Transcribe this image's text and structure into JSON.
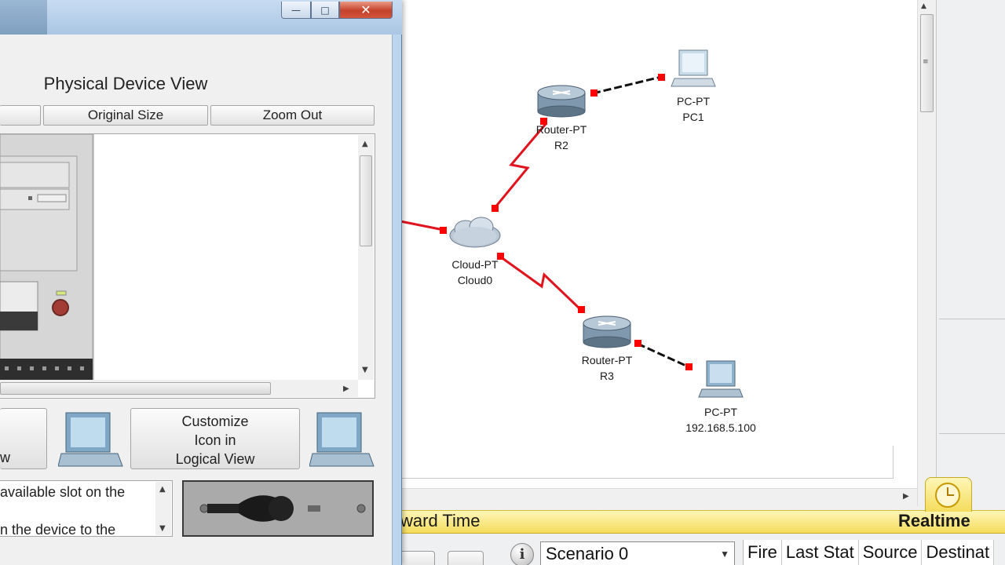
{
  "workspace": {
    "devices": [
      {
        "name": "cloud",
        "type_label": "Cloud-PT",
        "name_label": "Cloud0"
      },
      {
        "name": "router-r2",
        "type_label": "Router-PT",
        "name_label": "R2"
      },
      {
        "name": "router-r3",
        "type_label": "Router-PT",
        "name_label": "R3"
      },
      {
        "name": "pc-pc1",
        "type_label": "PC-PT",
        "name_label": "PC1"
      },
      {
        "name": "pc-ip",
        "type_label": "PC-PT",
        "name_label": "192.168.5.100"
      }
    ],
    "link_colors": {
      "serial": "#e0141e",
      "ethernet": "#111111",
      "port": "#ff0000"
    }
  },
  "toolbar": {
    "tools": [
      "select-icon",
      "hand-icon",
      "note-icon",
      "delete-icon",
      "inspect-icon",
      "resize-icon",
      "add-simple-pdu-icon",
      "add-complex-pdu-icon"
    ],
    "accent": "#9fcdf5"
  },
  "timebar": {
    "mode_left": "ward Time",
    "mode_right": "Realtime"
  },
  "scenario": {
    "info": "i",
    "selected": "Scenario 0",
    "columns": [
      "Fire",
      "Last Stat",
      "Source",
      "Destinat"
    ]
  },
  "dialog": {
    "title": "Physical Device View",
    "buttons": {
      "original_size": "Original Size",
      "zoom_out": "Zoom Out"
    },
    "customize_lines": [
      "Customize",
      "Icon in",
      "Logical View"
    ],
    "left_button_tail": "w",
    "description_lines": [
      "available slot on the",
      "n the device to the"
    ],
    "window_controls": {
      "minimize": "—",
      "maximize": "□",
      "close": "✕"
    }
  }
}
